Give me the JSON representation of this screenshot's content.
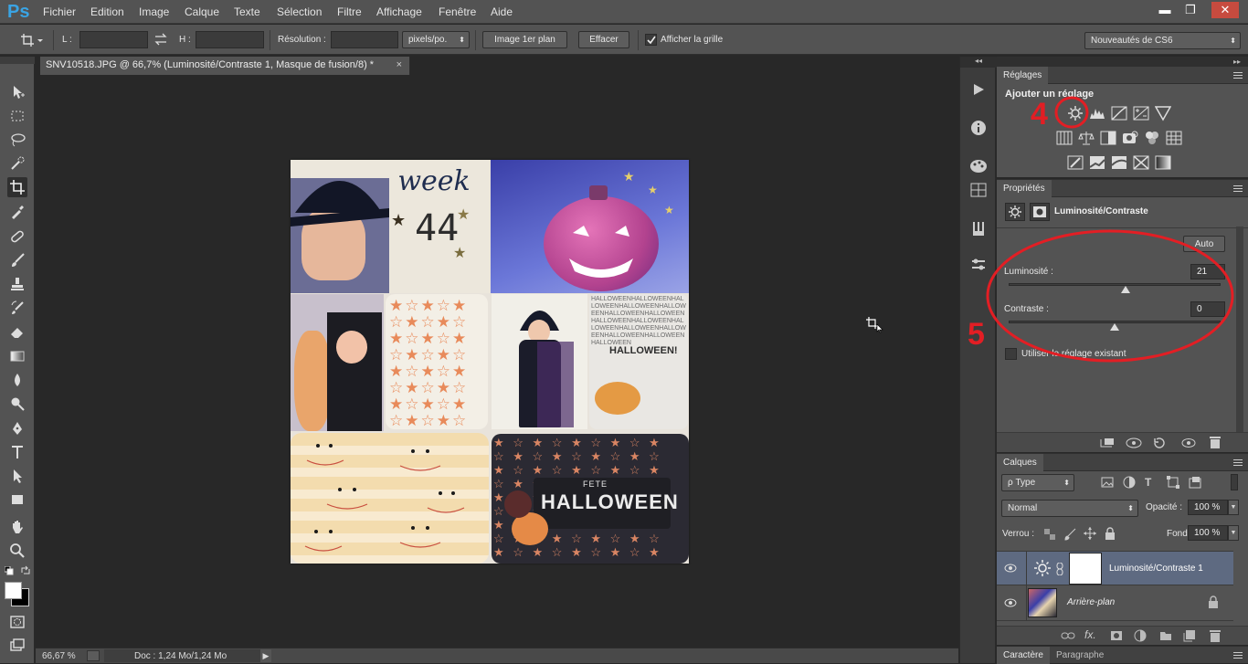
{
  "app": {
    "logo": "Ps"
  },
  "menu": [
    "Fichier",
    "Edition",
    "Image",
    "Calque",
    "Texte",
    "Sélection",
    "Filtre",
    "Affichage",
    "Fenêtre",
    "Aide"
  ],
  "window_buttons": {
    "minimize": "▬",
    "restore": "❐",
    "close": "✕"
  },
  "options": {
    "l_label": "L :",
    "h_label": "H :",
    "l_value": "",
    "h_value": "",
    "resolution_label": "Résolution :",
    "resolution_value": "",
    "unit_select": "pixels/po.",
    "front_image_button": "Image 1er plan",
    "clear_button": "Effacer",
    "grid_checkbox_label": "Afficher la grille",
    "grid_checked": true,
    "workspace_select": "Nouveautés de CS6"
  },
  "document": {
    "tab_title": "SNV10518.JPG @ 66,7% (Luminosité/Contraste 1, Masque de fusion/8) *",
    "tab_close": "×"
  },
  "canvas_text": {
    "week": "week",
    "week_number": "44",
    "halloween_card": "HALLOWEEN!",
    "fete": "FETE",
    "halloween_big": "HALLOWEEN"
  },
  "status": {
    "zoom": "66,67 %",
    "doc": "Doc : 1,24 Mo/1,24 Mo"
  },
  "annotations": {
    "step4": "4",
    "step5": "5",
    "color": "#e31e24"
  },
  "adjustments": {
    "tab": "Réglages",
    "add_label": "Ajouter un réglage",
    "row1": [
      "brightness-contrast-icon",
      "levels-icon",
      "curves-icon",
      "exposure-icon",
      "gradient-triangle-icon"
    ],
    "row2": [
      "vibrance-icon",
      "balance-icon",
      "bw-icon",
      "photo-filter-icon",
      "channel-mixer-icon",
      "color-lookup-icon"
    ],
    "row3": [
      "invert-icon",
      "posterize-icon",
      "threshold-icon",
      "selective-color-icon",
      "gradient-map-icon"
    ]
  },
  "properties": {
    "tab": "Propriétés",
    "title": "Luminosité/Contraste",
    "auto_button": "Auto",
    "brightness_label": "Luminosité :",
    "brightness_value": "21",
    "contrast_label": "Contraste :",
    "contrast_value": "0",
    "legacy_label": "Utiliser le réglage existant",
    "brightness_level": 0.5525,
    "contrast_level": 0.5
  },
  "layers": {
    "tab": "Calques",
    "filter": "ρ Type",
    "blend_mode": "Normal",
    "opacity_label": "Opacité :",
    "opacity_value": "100 %",
    "lock_label": "Verrou :",
    "fill_label": "Fond :",
    "fill_value": "100 %",
    "items": [
      {
        "name": "Luminosité/Contraste 1",
        "selected": true
      },
      {
        "name": "Arrière-plan",
        "selected": false
      }
    ]
  },
  "bottom_tabs": {
    "character": "Caractère",
    "paragraph": "Paragraphe"
  }
}
